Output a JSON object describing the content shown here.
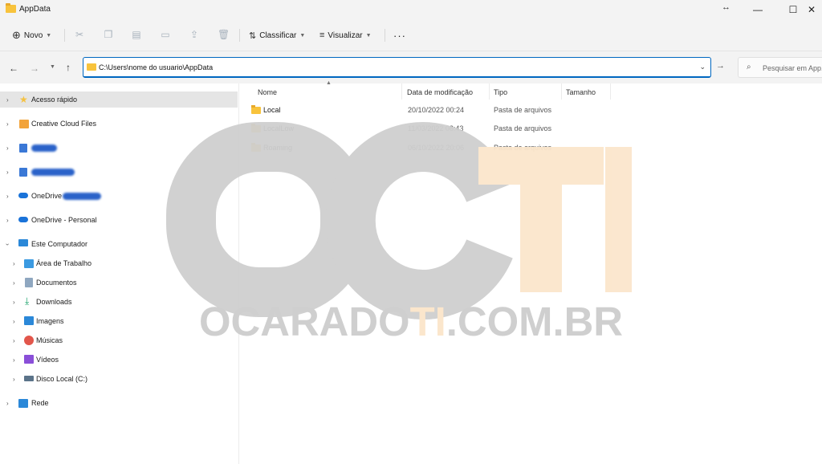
{
  "window": {
    "title": "AppData",
    "resize_icon": "resize-icon",
    "controls": [
      "—",
      "☐",
      "✕"
    ]
  },
  "toolbar": {
    "new_label": "Novo",
    "sort_label": "Classificar",
    "view_label": "Visualizar",
    "more_label": "···"
  },
  "address": {
    "path": "C:\\Users\\nome do usuario\\AppData",
    "search_placeholder": "Pesquisar em App..."
  },
  "sidebar": {
    "items": [
      {
        "label": "Acesso rápido",
        "icon": "star-icon",
        "color": "#f5c242"
      },
      {
        "label": "Creative Cloud Files",
        "icon": "creative-cloud-icon",
        "color": "#f2a33a"
      },
      {
        "label": "",
        "icon": "network-drive-icon",
        "color": "#3a78d6"
      },
      {
        "label": "",
        "icon": "network-drive-icon",
        "color": "#3a78d6"
      },
      {
        "label": "OneDrive",
        "icon": "onedrive-icon",
        "color": "#1a73d9"
      },
      {
        "label": "OneDrive - Personal",
        "icon": "onedrive-icon",
        "color": "#1a73d9"
      },
      {
        "label": "Este Computador",
        "icon": "computer-icon",
        "color": "#2b88d8"
      },
      {
        "label": "Área de Trabalho",
        "icon": "desktop-icon",
        "color": "#3b9ae1"
      },
      {
        "label": "Documentos",
        "icon": "documents-icon",
        "color": "#8fa7c0"
      },
      {
        "label": "Downloads",
        "icon": "downloads-icon",
        "color": "#1aa36b"
      },
      {
        "label": "Imagens",
        "icon": "pictures-icon",
        "color": "#2b88d8"
      },
      {
        "label": "Músicas",
        "icon": "music-icon",
        "color": "#e2564b"
      },
      {
        "label": "Vídeos",
        "icon": "videos-icon",
        "color": "#8a4fd8"
      },
      {
        "label": "Disco Local (C:)",
        "icon": "drive-icon",
        "color": "#5b7389"
      },
      {
        "label": "Rede",
        "icon": "network-icon",
        "color": "#2b88d8"
      }
    ]
  },
  "list": {
    "columns": [
      "Nome",
      "Data de modificação",
      "Tipo",
      "Tamanho"
    ],
    "rows": [
      {
        "name": "Local",
        "date": "20/10/2022 00:24",
        "type": "Pasta de arquivos"
      },
      {
        "name": "LocalLow",
        "date": "11/03/2022 08:43",
        "type": "Pasta de arquivos"
      },
      {
        "name": "Roaming",
        "date": "06/10/2022 20:06",
        "type": "Pasta de arquivos"
      }
    ]
  },
  "watermark": {
    "logo_text": "OCTI",
    "site_text": "OCARADOTI.COM.BR",
    "gray": "#cfcfcf",
    "orange": "#fbe6cc"
  }
}
